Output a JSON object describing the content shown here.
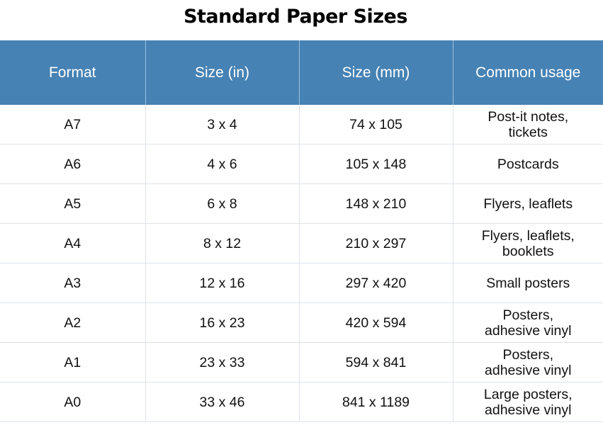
{
  "title": "Standard Paper Sizes",
  "table": {
    "headers": [
      "Format",
      "Size (in)",
      "Size (mm)",
      "Common usage"
    ],
    "rows": [
      {
        "format": "A7",
        "size_in": "3 x 4",
        "size_mm": "74 x 105",
        "usage_line1": "Post-it notes,",
        "usage_line2": "tickets"
      },
      {
        "format": "A6",
        "size_in": "4 x 6",
        "size_mm": "105 x 148",
        "usage_line1": "Postcards",
        "usage_line2": ""
      },
      {
        "format": "A5",
        "size_in": "6 x 8",
        "size_mm": "148 x 210",
        "usage_line1": "Flyers, leaflets",
        "usage_line2": ""
      },
      {
        "format": "A4",
        "size_in": "8 x 12",
        "size_mm": "210 x 297",
        "usage_line1": "Flyers, leaflets,",
        "usage_line2": "booklets"
      },
      {
        "format": "A3",
        "size_in": "12 x 16",
        "size_mm": "297 x 420",
        "usage_line1": "Small posters",
        "usage_line2": ""
      },
      {
        "format": "A2",
        "size_in": "16 x 23",
        "size_mm": "420 x 594",
        "usage_line1": "Posters,",
        "usage_line2": "adhesive vinyl"
      },
      {
        "format": "A1",
        "size_in": "23 x 33",
        "size_mm": "594 x 841",
        "usage_line1": "Posters,",
        "usage_line2": "adhesive vinyl"
      },
      {
        "format": "A0",
        "size_in": "33 x 46",
        "size_mm": "841 x 1189",
        "usage_line1": "Large posters,",
        "usage_line2": "adhesive vinyl"
      }
    ]
  },
  "colors": {
    "header_bg": "#4682b4",
    "header_text": "#ffffff",
    "grid": "#dde3ea"
  }
}
